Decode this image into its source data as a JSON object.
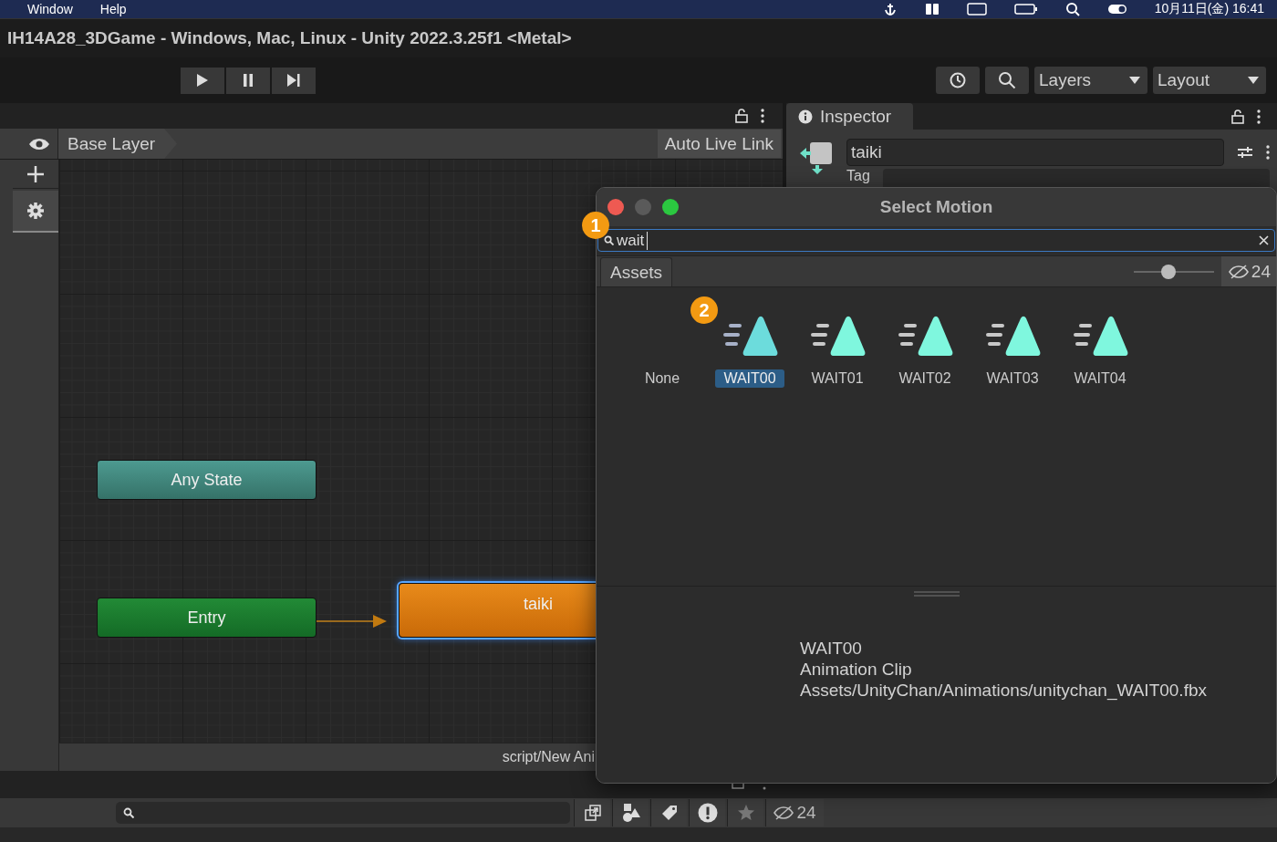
{
  "menu_bar": {
    "items": [
      "Window",
      "Help"
    ],
    "clock": "10月11日(金) 16:41"
  },
  "window": {
    "title": "IH14A28_3DGame - Windows, Mac, Linux - Unity 2022.3.25f1 <Metal>"
  },
  "toolbar": {
    "layers": "Layers",
    "layout": "Layout"
  },
  "animator": {
    "breadcrumb": "Base Layer",
    "auto_live_link": "Auto Live Link",
    "nodes": [
      {
        "kind": "any",
        "label": "Any State",
        "selected": false
      },
      {
        "kind": "entry",
        "label": "Entry",
        "selected": false
      },
      {
        "kind": "state",
        "label": "taiki",
        "selected": true
      }
    ],
    "status_path": "script/New Ani"
  },
  "inspector": {
    "tab": "Inspector",
    "name": "taiki",
    "tag_label": "Tag"
  },
  "select_motion": {
    "title": "Select Motion",
    "search": "wait",
    "tabs": [
      {
        "label": "Assets",
        "selected": true
      }
    ],
    "zoom": {
      "level": 0.43
    },
    "hidden_count": "24",
    "items": [
      {
        "kind": "none",
        "label": "None",
        "selected": false
      },
      {
        "kind": "clip",
        "label": "WAIT00",
        "selected": true
      },
      {
        "kind": "clip",
        "label": "WAIT01",
        "selected": false
      },
      {
        "kind": "clip",
        "label": "WAIT02",
        "selected": false
      },
      {
        "kind": "clip",
        "label": "WAIT03",
        "selected": false
      },
      {
        "kind": "clip",
        "label": "WAIT04",
        "selected": false
      }
    ],
    "preview": [
      "WAIT00",
      "Animation Clip",
      "Assets/UnityChan/Animations/unitychan_WAIT00.fbx"
    ]
  },
  "callouts": [
    "1",
    "2"
  ],
  "project": {
    "hidden_count": "24"
  }
}
